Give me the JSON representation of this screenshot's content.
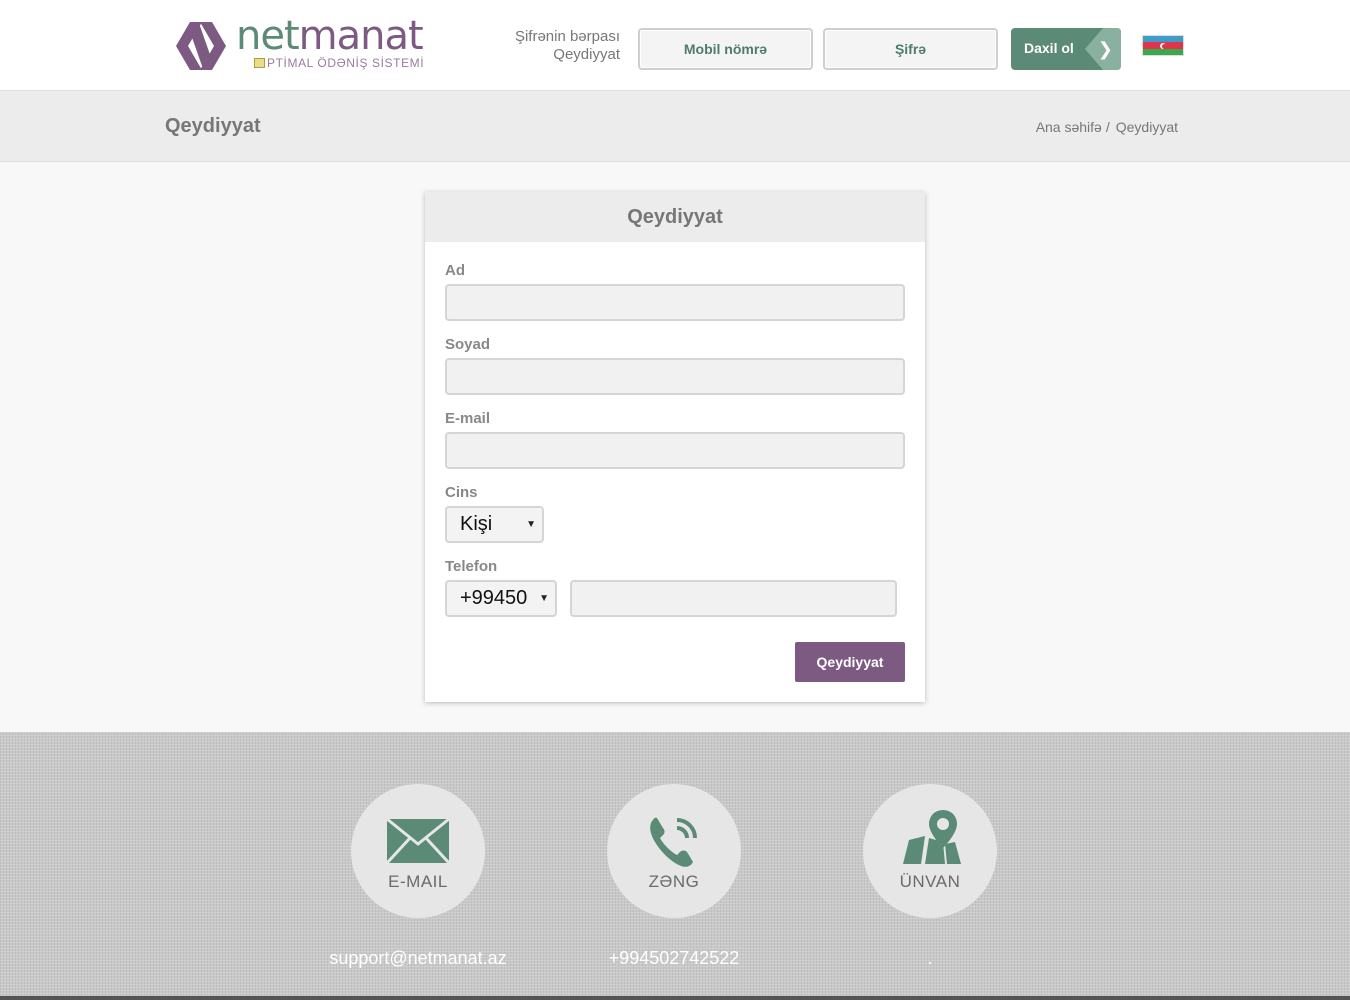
{
  "brand": {
    "name_part1": "net",
    "name_part2": "manat",
    "tagline": "PTİMAL ÖDƏNİŞ SİSTEMİ",
    "color_green": "#5b8a76",
    "color_purple": "#7d5a82"
  },
  "header": {
    "links": [
      "Şifrənin bərpası",
      "Qeydiyyat"
    ],
    "mobile_label": "Mobil nömrə",
    "password_label": "Şifrə",
    "login_label": "Daxil ol",
    "language_flag": "az-flag-icon"
  },
  "titlebar": {
    "title": "Qeydiyyat",
    "breadcrumb": [
      "Ana səhifə",
      "Qeydiyyat"
    ]
  },
  "form": {
    "heading": "Qeydiyyat",
    "first_name": {
      "label": "Ad",
      "value": ""
    },
    "last_name": {
      "label": "Soyad",
      "value": ""
    },
    "email": {
      "label": "E-mail",
      "value": ""
    },
    "gender": {
      "label": "Cins",
      "selected": "Kişi"
    },
    "phone": {
      "label": "Telefon",
      "prefix": "+99450",
      "number": ""
    },
    "submit_label": "Qeydiyyat"
  },
  "footer": {
    "contacts": [
      {
        "caption": "E-MAIL",
        "value": "support@netmanat.az",
        "icon": "envelope-icon"
      },
      {
        "caption": "ZƏNG",
        "value": "+994502742522",
        "icon": "phone-icon"
      },
      {
        "caption": "ÜNVAN",
        "value": ".",
        "icon": "map-pin-icon"
      }
    ]
  }
}
